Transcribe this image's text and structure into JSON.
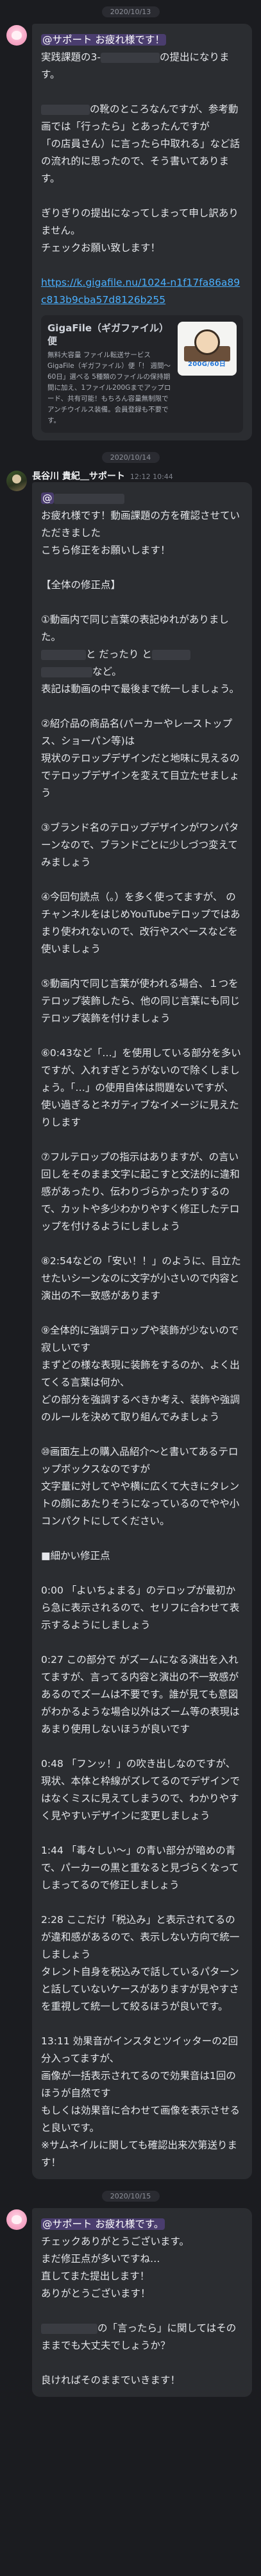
{
  "messages": [
    {
      "date": "2020/10/13",
      "sender": "",
      "time": "",
      "avatar": "pink-bunny-avatar",
      "lines": [
        "@サポート お疲れ様です！",
        "実践課題の3-",
        "の提出になります。",
        "",
        "の靴のところなんですが、参考動画では「行ったら」とあったんですが",
        "「の店員さん）に言ったら中取れる」など話の流れ的に思ったので、そう書いてあります。",
        "",
        "ぎりぎりの提出になってしまって申し訳ありません。",
        "チェックお願い致します！"
      ],
      "link": "https://k.gigafile.nu/1024-n1f17fa86a89c813b9cba57d8126b255",
      "link_card": {
        "title": "GigaFile（ギガファイル）便",
        "description": "無料大容量 ファイル転送サービス GigaFile（ギガファイル）便「！ 週間～60日」選べる 5種類のファイルの保持期間に加え、1ファイル200Gまでアップロード、共有可能！もちろん容量無制限でアンチウイルス装備。会員登録も不要です。",
        "thumb_label": "200G/60日"
      }
    },
    {
      "date": "2020/10/14",
      "sender": "長谷川 貴紀＿サポート",
      "time": "12:12 10:44",
      "avatar": "photo-avatar",
      "lines": [
        "@",
        "お疲れ様です！動画課題の方を確認させていただきました",
        "こちら修正をお願いします！",
        "",
        "【全体の修正点】",
        "",
        "①動画内で同じ言葉の表記ゆれがありました。",
        "と だったり と",
        "など。",
        "表記は動画の中で最後まで統一しましょう。",
        "",
        "②紹介品の商品名(パーカーやレーストップス、ショーパン等)は",
        "現状のテロップデザインだと地味に見えるのでテロップデザインを変えて目立たせましょう",
        "",
        "③ブランド名のテロップデザインがワンパターンなので、ブランドごとに少しづつ変えてみましょう",
        "",
        "④今回句読点（。）を多く使ってますが、 のチャンネルをはじめYouTubeテロップではあまり使われないので、改行やスペースなどを使いましょう",
        "",
        "⑤動画内で同じ言葉が使われる場合、１つをテロップ装飾したら、他の同じ言葉にも同じテロップ装飾を付けましょう",
        "",
        "⑥0:43など「…」を使用している部分を多いですが、入れすぎとうがないので除くしましょう。「…」の使用自体は問題ないですが、使い過ぎるとネガティブなイメージに見えたりします",
        "",
        "⑦フルテロップの指示はありますが、の言い回しをそのまま文字に起こすと文法的に違和感があったり、伝わりづらかったりするので、カットや多少わかりやすく修正したテロップを付けるようにしましょう",
        "",
        "⑧2:54などの「安い！！」のように、目立たせたいシーンなのに文字が小さいので内容と演出の不一致感があります",
        "",
        "⑨全体的に強調テロップや装飾が少ないので寂しいです",
        "まずどの様な表現に装飾をするのか、よく出てくる言葉は何か、",
        "どの部分を強調するべきか考え、装飾や強調のルールを決めて取り組んでみましょう",
        "",
        "⑩画面左上の購入品紹介〜と書いてあるテロップボックスなのですが",
        "文字量に対してやや横に広くて大きにタレントの顔にあたりそうになっているのでやや小コンパクトにしてください。",
        "",
        "■細かい修正点",
        "",
        "0:00 「よいちょまる」のテロップが最初から急に表示されるので、セリフに合わせて表示するようにしましょう",
        "",
        "0:27 この部分で がズームになる演出を入れてますが、言ってる内容と演出の不一致感があるのでズームは不要です。誰が見ても意図がわかるような場合以外はズーム等の表現はあまり使用しないほうが良いです",
        "",
        "0:48 「フンッ！」の吹き出しなのですが、現状、本体と枠線がズレてるのでデザインではなくミスに見えてしまうので、わかりやすく見やすいデザインに変更しましょう",
        "",
        "1:44 「毒々しい〜」の青い部分が暗めの青で、パーカーの黒と重なると見づらくなってしまってるので修正しましょう",
        "",
        "2:28 ここだけ「税込み」と表示されてるのが違和感があるので、表示しない方向で統一しましょう",
        "タレント自身を税込みで話しているパターンと話していないケースがありますが見やすさを重視して統一して絞るほうが良いです。",
        "",
        "13:11 効果音がインスタとツイッターの2回分入ってますが、",
        "画像が一括表示されてるので効果音は1回のほうが自然です",
        "もしくは効果音に合わせて画像を表示させると良いです。",
        "※サムネイルに関しても確認出来次第送ります！"
      ]
    },
    {
      "date": "2020/10/15",
      "sender": "",
      "time": "",
      "avatar": "pink-bunny-avatar",
      "lines": [
        "@サポート お疲れ様です。",
        "チェックありがとうございます。",
        "まだ修正点が多いですね…",
        "直してまた提出します！",
        "ありがとうございます！",
        "",
        "の「言ったら」に関してはそのままでも大丈夫でしょうか？",
        "",
        "良ければそのままでいきます！"
      ]
    }
  ]
}
